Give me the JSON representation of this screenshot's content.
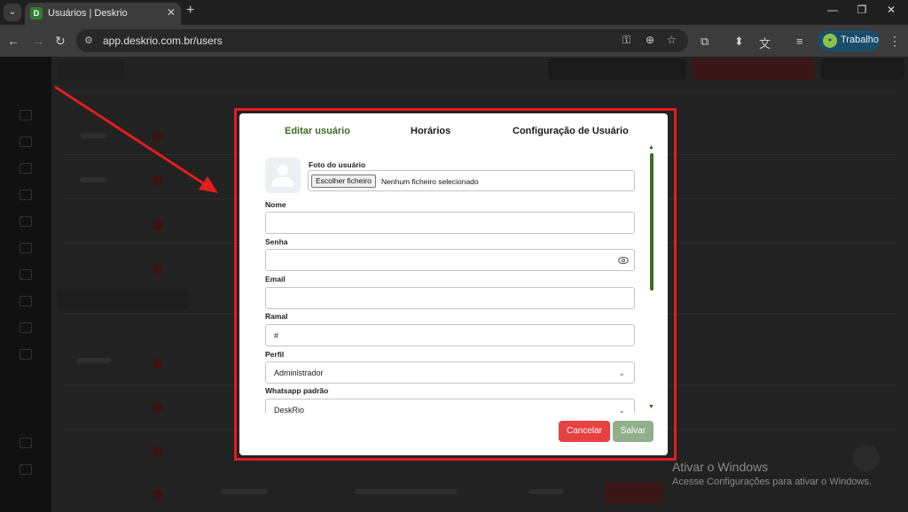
{
  "browser": {
    "tab_title": "Usuários | Deskrio",
    "url": "app.deskrio.com.br/users",
    "profile_label": "Trabalho",
    "tab_favicon_letter": "D"
  },
  "modal": {
    "tabs": [
      {
        "label": "Editar usuário",
        "active": true
      },
      {
        "label": "Horários",
        "active": false
      },
      {
        "label": "Configuração de Usuário",
        "active": false
      }
    ],
    "photo": {
      "label": "Foto do usuário",
      "button_label": "Escolher ficheiro",
      "status": "Nenhum ficheiro selecionado"
    },
    "fields": {
      "nome": {
        "label": "Nome",
        "value": ""
      },
      "senha": {
        "label": "Senha",
        "value": ""
      },
      "email": {
        "label": "Email",
        "value": ""
      },
      "ramal": {
        "label": "Ramal",
        "value": "#"
      },
      "perfil": {
        "label": "Perfil",
        "value": "Administrador"
      },
      "whatsapp": {
        "label": "Whatsapp padrão",
        "value": "DeskRio"
      }
    },
    "buttons": {
      "cancel": "Cancelar",
      "save": "Salvar"
    }
  },
  "watermark": {
    "title": "Ativar o Windows",
    "subtitle": "Acesse Configurações para ativar o Windows."
  },
  "colors": {
    "accent_green": "#3c6b24",
    "highlight_red": "#e21d1d",
    "cancel_red": "#e84141",
    "save_disabled_green": "#8fb08a"
  }
}
